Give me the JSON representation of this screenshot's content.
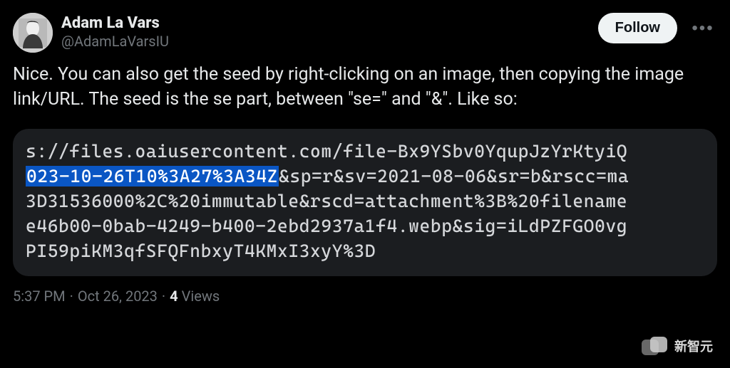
{
  "user": {
    "display_name": "Adam La Vars",
    "handle": "@AdamLaVarsIU"
  },
  "actions": {
    "follow_label": "Follow"
  },
  "tweet_text": "Nice. You can also get the seed by right-clicking on an image, then copying the image link/URL.  The seed is the se part, between \"se=\" and \"&\". Like so:",
  "url_block": {
    "line1_pre": "s://files.oaiusercontent.com/file-Bx9YSbv0YqupJzYrKtyiQ",
    "line2_highlight": "023-10-26T10%3A27%3A34Z",
    "line2_rest": "&sp=r&sv=2021-08-06&sr=b&rscc=ma",
    "line3": "3D31536000%2C%20immutable&rscd=attachment%3B%20filename",
    "line4": "e46b00-0bab-4249-b400-2ebd2937a1f4.webp&sig=iLdPZFGO0vg",
    "line5": "PI59piKM3qfSFQFnbxyT4KMxI3xyY%3D"
  },
  "meta": {
    "time": "5:37 PM",
    "sep": "·",
    "date": "Oct 26, 2023",
    "views_count": "4",
    "views_label": "Views"
  },
  "watermark": {
    "text": "新智元"
  }
}
